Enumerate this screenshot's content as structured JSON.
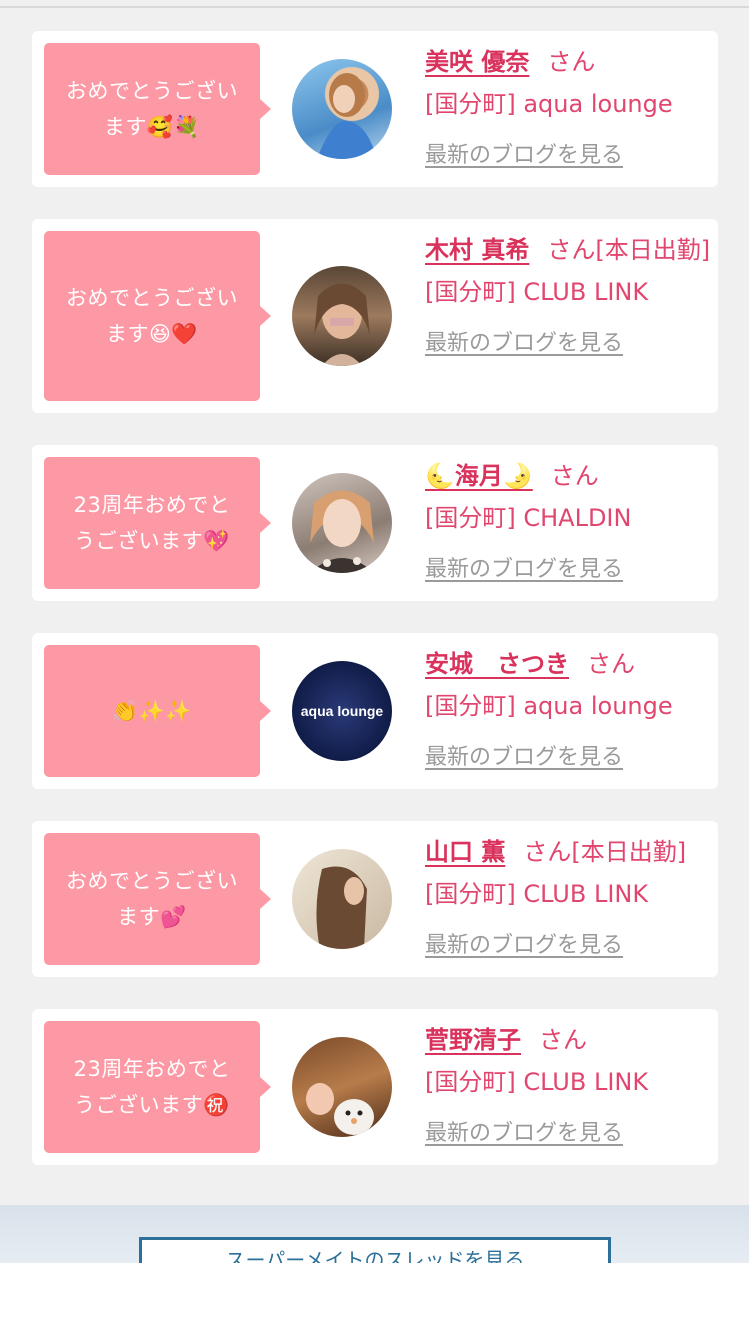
{
  "entries": [
    {
      "message": [
        "おめでとうござい",
        "ます🥰💐"
      ],
      "name": "美咲 優奈",
      "suffix": "さん",
      "shop": "[国分町] aqua lounge",
      "blog": "最新のブログを見る"
    },
    {
      "message": [
        "おめでとうござい",
        "ます😆❤️"
      ],
      "name": "木村 真希",
      "suffix": "さん[本日出勤]",
      "shop": "[国分町] CLUB LINK",
      "blog": "最新のブログを見る"
    },
    {
      "message": [
        "23周年おめでと",
        "うございます💖"
      ],
      "name": "🌜海月🌛",
      "suffix": "さん",
      "shop": "[国分町] CHALDIN",
      "blog": "最新のブログを見る"
    },
    {
      "message": [
        "👏✨✨"
      ],
      "name": "安城　さつき",
      "suffix": "さん",
      "shop": "[国分町] aqua lounge",
      "blog": "最新のブログを見る",
      "avatar_text": "aqua lounge"
    },
    {
      "message": [
        "おめでとうござい",
        "ます💕"
      ],
      "name": "山口 薫",
      "suffix": "さん[本日出勤]",
      "shop": "[国分町] CLUB LINK",
      "blog": "最新のブログを見る"
    },
    {
      "message": [
        "23周年おめでと",
        "うございます㊗️"
      ],
      "name": "菅野清子",
      "suffix": "さん",
      "shop": "[国分町] CLUB LINK",
      "blog": "最新のブログを見る"
    }
  ],
  "footer": {
    "more_button_label": "スーパーメイトのスレッドを見る"
  }
}
